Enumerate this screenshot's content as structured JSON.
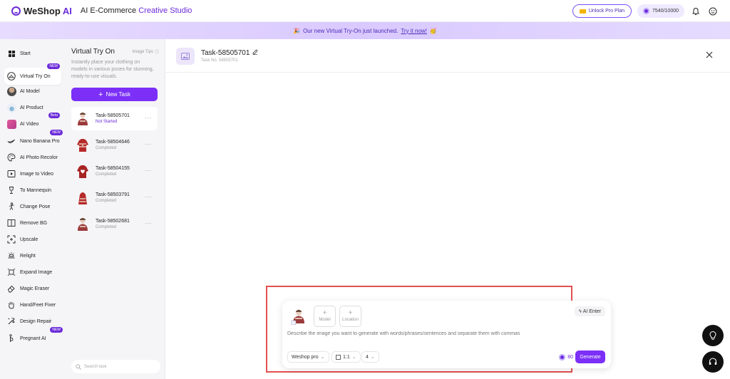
{
  "header": {
    "logo_brand": "WeShop",
    "logo_ai": "AI",
    "title_main": "AI E-Commerce",
    "title_accent": "Creative Studio",
    "pro_button": "Unlock Pro Plan",
    "credits": "7540/10000"
  },
  "banner": {
    "text": "Our new Virtual Try-On just launched.",
    "link": "Try it now!"
  },
  "sidebar": {
    "items": [
      {
        "label": "Start",
        "icon": "grid-icon"
      },
      {
        "label": "Virtual Try On",
        "icon": "hanger-icon",
        "badge": "NEW"
      },
      {
        "label": "AI Model",
        "icon": "model-thumb"
      },
      {
        "label": "AI Product",
        "icon": "product-thumb"
      },
      {
        "label": "AI Video",
        "icon": "video-thumb",
        "badge": "Beta"
      },
      {
        "label": "Nano Banana Pro",
        "icon": "banana-icon",
        "badge": "NEW"
      },
      {
        "label": "AI Photo Recolor",
        "icon": "palette-icon"
      },
      {
        "label": "Image to Video",
        "icon": "play-icon"
      },
      {
        "label": "To Mannequin",
        "icon": "mannequin-icon"
      },
      {
        "label": "Change Pose",
        "icon": "pose-icon"
      },
      {
        "label": "Remove BG",
        "icon": "remove-bg-icon"
      },
      {
        "label": "Upscale",
        "icon": "upscale-icon"
      },
      {
        "label": "Relight",
        "icon": "relight-icon"
      },
      {
        "label": "Expand Image",
        "icon": "expand-icon"
      },
      {
        "label": "Magic Eraser",
        "icon": "eraser-icon"
      },
      {
        "label": "Hand/Feet Fixer",
        "icon": "hand-icon"
      },
      {
        "label": "Design Repair",
        "icon": "repair-icon"
      },
      {
        "label": "Pregnant AI",
        "icon": "pregnant-icon",
        "badge": "NEW"
      }
    ]
  },
  "task_panel": {
    "title": "Virtual Try On",
    "tips": "Image Tips",
    "description": "Instantly place your clothing on models in various poses for stunning, ready-to-use visuals.",
    "new_task": "New Task",
    "search_placeholder": "Search task",
    "tasks": [
      {
        "name": "Task-58505701",
        "status": "Not Started"
      },
      {
        "name": "Task-58504646",
        "status": "Completed"
      },
      {
        "name": "Task-58504155",
        "status": "Completed"
      },
      {
        "name": "Task-58503791",
        "status": "Completed"
      },
      {
        "name": "Task-58502681",
        "status": "Completed"
      }
    ]
  },
  "main": {
    "task_title": "Task-58505701",
    "task_no": "Task No. 58505701"
  },
  "prompt": {
    "model_label": "Model",
    "location_label": "Location",
    "ai_enter": "AI Enter",
    "placeholder": "Describe the image you want to generate with words/phrases/sentences and separate them with commas",
    "model_select": "Weshop pro",
    "ratio_select": "1:1",
    "count_select": "4",
    "credit_cost": "80",
    "generate": "Generate"
  },
  "colors": {
    "accent": "#7b2ff7",
    "brand": "#6b2bd9",
    "highlight_frame": "#e35050"
  }
}
